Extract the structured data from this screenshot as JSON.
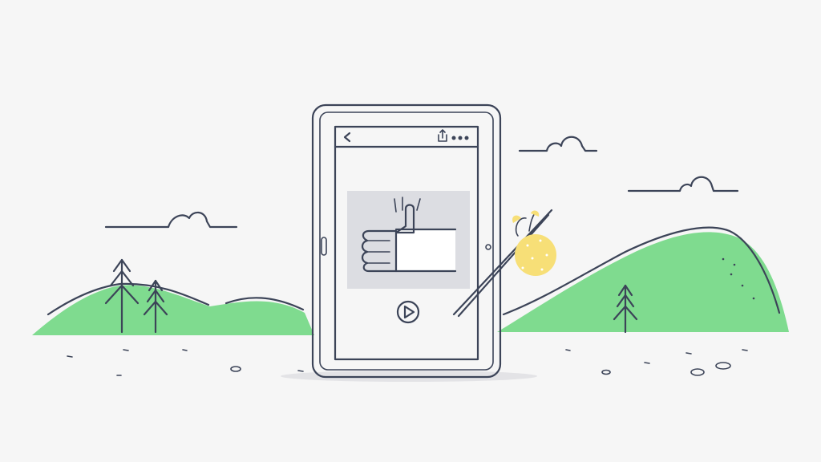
{
  "scene": {
    "background_color": "#f6f6f6",
    "hill_color": "#7fdb8f",
    "ink_color": "#3c4458",
    "video_placeholder_color": "#dcdde2",
    "bundle_color": "#f7df77"
  },
  "tablet": {
    "top_bar": {
      "back_icon": "back-chevron-icon",
      "share_icon": "share-icon",
      "more_icon": "more-dots-icon"
    },
    "content": {
      "thumbnail_icon": "thumbs-up-icon",
      "play_icon": "play-button-icon"
    }
  }
}
